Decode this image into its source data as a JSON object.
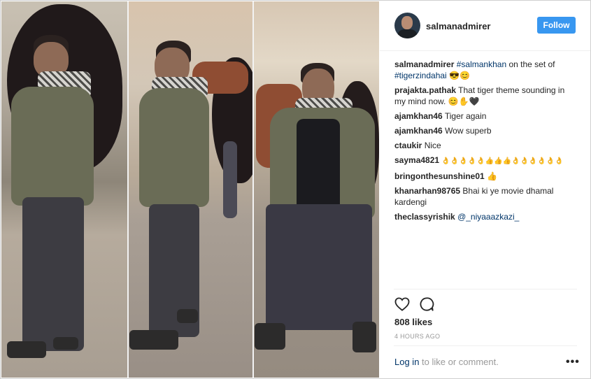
{
  "post": {
    "username": "salmanadmirer",
    "follow_label": "Follow",
    "caption": {
      "username": "salmanadmirer",
      "hashtag1": "#salmankhan",
      "text": " on the set of ",
      "hashtag2": "#tigerzindahai",
      "emoji": " 😎😊"
    },
    "comments": [
      {
        "user": "prajakta.pathak",
        "text": "That tiger theme sounding in my mind now. 😊✋🖤"
      },
      {
        "user": "ajamkhan46",
        "text": "Tiger again"
      },
      {
        "user": "ajamkhan46",
        "text": "Wow superb"
      },
      {
        "user": "ctaukir",
        "text": "Nice"
      },
      {
        "user": "sayma4821",
        "text": "👌👌👌👌👌👍👍👍👌👌👌👌👌👌"
      },
      {
        "user": "bringonthesunshine01",
        "text": "👍"
      },
      {
        "user": "khanarhan98765",
        "text": "Bhai ki ye movie dhamal kardengi"
      },
      {
        "user": "theclassyrishik",
        "mention": "@_niyaaazkazi_"
      }
    ],
    "likes": "808 likes",
    "time": "4 HOURS AGO",
    "login_link": "Log in",
    "login_text": " to like or comment.",
    "more_label": "•••"
  }
}
